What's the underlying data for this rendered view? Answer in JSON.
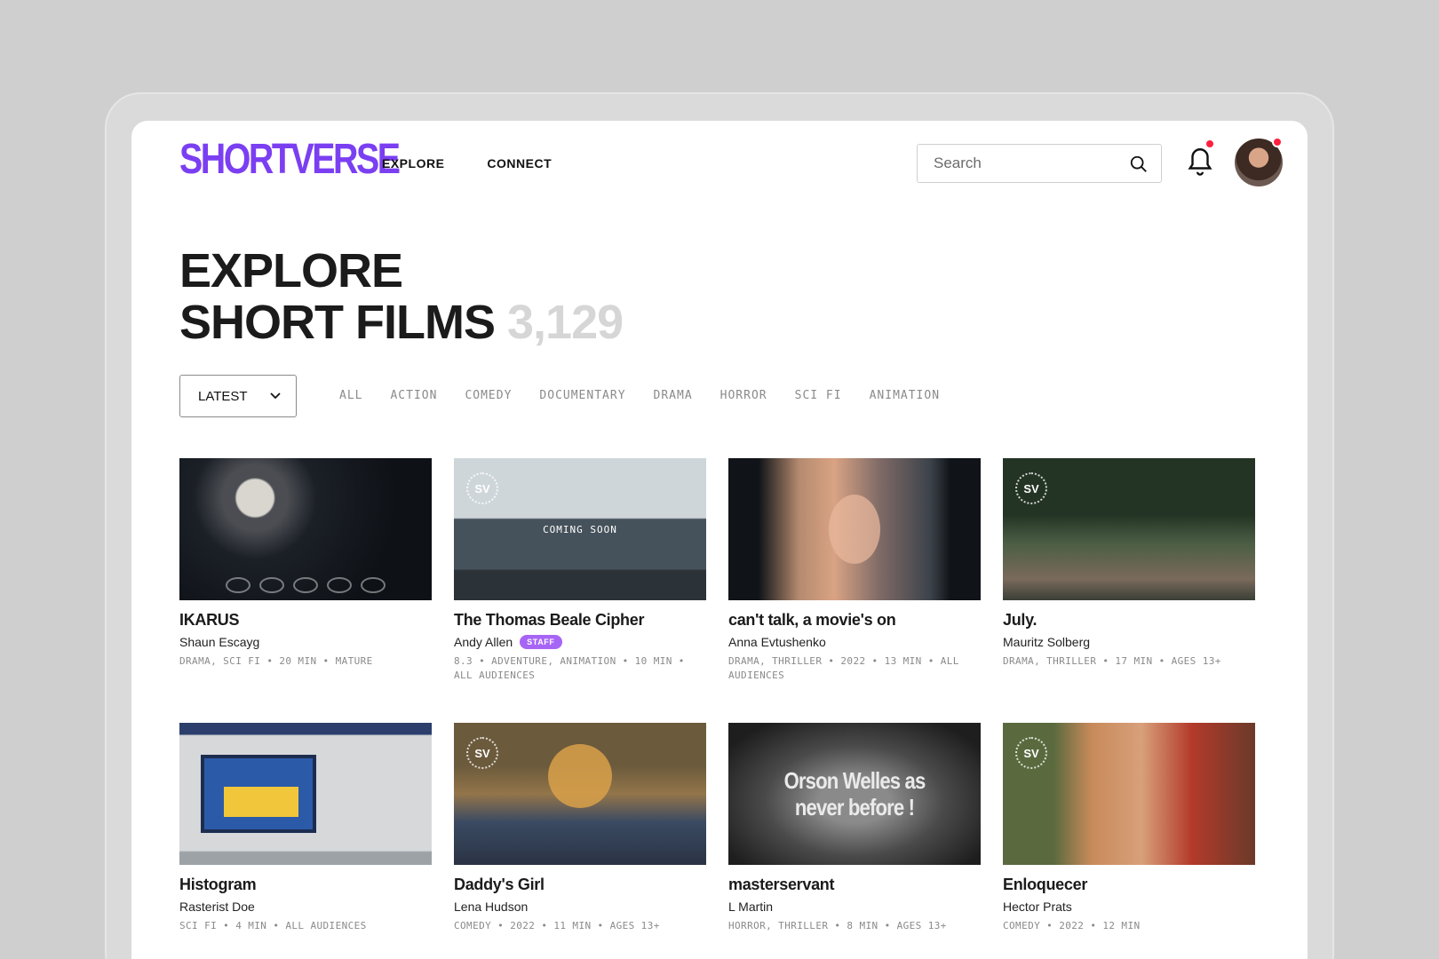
{
  "brand": {
    "logo": "SHORTVERSE",
    "accent": "#7b3ff2"
  },
  "nav": {
    "explore": "EXPLORE",
    "connect": "CONNECT"
  },
  "search": {
    "placeholder": "Search"
  },
  "page": {
    "title_line1": "EXPLORE",
    "title_line2": "SHORT FILMS",
    "count": "3,129"
  },
  "sort": {
    "selected": "LATEST"
  },
  "genres": [
    "ALL",
    "ACTION",
    "COMEDY",
    "DOCUMENTARY",
    "DRAMA",
    "HORROR",
    "SCI FI",
    "ANIMATION"
  ],
  "films": [
    {
      "title": "IKARUS",
      "creator": "Shaun Escayg",
      "staff": "",
      "meta": "DRAMA, SCI FI • 20 MIN • MATURE"
    },
    {
      "title": "The Thomas Beale Cipher",
      "creator": "Andy Allen",
      "staff": "STAFF",
      "meta": "8.3 • ADVENTURE, ANIMATION • 10 MIN • ALL AUDIENCES",
      "thumb_text": "COMING SOON"
    },
    {
      "title": "can't talk, a movie's on",
      "creator": "Anna Evtushenko",
      "staff": "",
      "meta": "DRAMA, THRILLER • 2022 • 13 MIN • ALL AUDIENCES"
    },
    {
      "title": "July.",
      "creator": "Mauritz Solberg",
      "staff": "",
      "meta": "DRAMA, THRILLER • 17 MIN • AGES 13+"
    },
    {
      "title": "Histogram",
      "creator": "Rasterist Doe",
      "staff": "",
      "meta": "SCI FI • 4 MIN • ALL AUDIENCES"
    },
    {
      "title": "Daddy's Girl",
      "creator": "Lena Hudson",
      "staff": "",
      "meta": "COMEDY • 2022 • 11 MIN • AGES 13+"
    },
    {
      "title": "masterservant",
      "creator": "L Martin",
      "staff": "",
      "meta": "HORROR, THRILLER • 8 MIN • AGES 13+",
      "thumb_text": "Orson Welles as never before !"
    },
    {
      "title": "Enloquecer",
      "creator": "Hector Prats",
      "staff": "",
      "meta": "COMEDY • 2022 • 12 MIN"
    }
  ]
}
